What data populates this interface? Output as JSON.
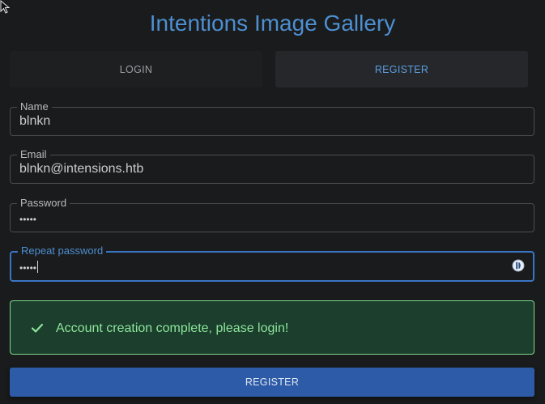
{
  "app": {
    "title": "Intentions Image Gallery"
  },
  "tabs": [
    {
      "label": "LOGIN",
      "active": false
    },
    {
      "label": "REGISTER",
      "active": true
    }
  ],
  "form": {
    "name": {
      "label": "Name",
      "value": "blnkn"
    },
    "email": {
      "label": "Email",
      "value": "blnkn@intensions.htb"
    },
    "password": {
      "label": "Password",
      "value": "•••••"
    },
    "repeat_password": {
      "label": "Repeat password",
      "value": "•••••",
      "focused": true
    }
  },
  "alert": {
    "type": "success",
    "message": "Account creation complete, please login!",
    "icon": "check-icon"
  },
  "submit": {
    "label": "REGISTER"
  },
  "colors": {
    "background": "#1a1b1c",
    "title": "#4d8fd1",
    "focus_border": "#3a75c4",
    "success_bg": "#1b3e2d",
    "success_border": "#7fd98b",
    "success_text": "#8ee59a",
    "button_bg": "#2d5ba7"
  }
}
